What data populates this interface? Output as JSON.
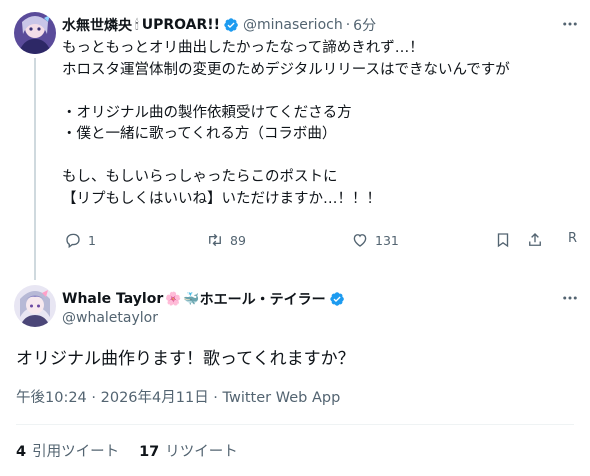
{
  "reply_parent": {
    "author_name": "水無世燐央",
    "author_badge_emoji": "🕯",
    "author_suffix": "UPROAR!!",
    "handle": "@minaserioch",
    "separator": "·",
    "time_ago": "6分",
    "lines": [
      "もっともっとオリ曲出したかったなって諦めきれず…！",
      "ホロスタ運営体制の変更のためデジタルリリースはできないんですが",
      "",
      "・オリジナル曲の製作依頼受けてくださる方",
      "・僕と一緒に歌ってくれる方（コラボ曲）",
      "",
      "もし、もしいらっしゃったらこのポストに",
      "【リプもしくはいいね】いただけますか…！！！"
    ],
    "actions": {
      "reply_count": "1",
      "retweet_count": "89",
      "like_count": "131",
      "truncated_label": "R"
    }
  },
  "main_tweet": {
    "author_name": "Whale Taylor",
    "author_emoji_1": "🌸",
    "author_emoji_2": "🐳",
    "author_name_jp": "ホエール・テイラー",
    "handle": "@whaletaylor",
    "text": "オリジナル曲作ります！歌ってくれますか？",
    "meta": "午後10:24 · 2026年4月11日 · Twitter Web App",
    "stats": {
      "quote_count": "4",
      "quote_label": "引用ツイート",
      "retweet_count": "17",
      "retweet_label": "リツイート"
    }
  },
  "colors": {
    "text": "#0f1419",
    "muted": "#536471",
    "verified": "#1d9bf0",
    "divider": "#eff3f4"
  }
}
